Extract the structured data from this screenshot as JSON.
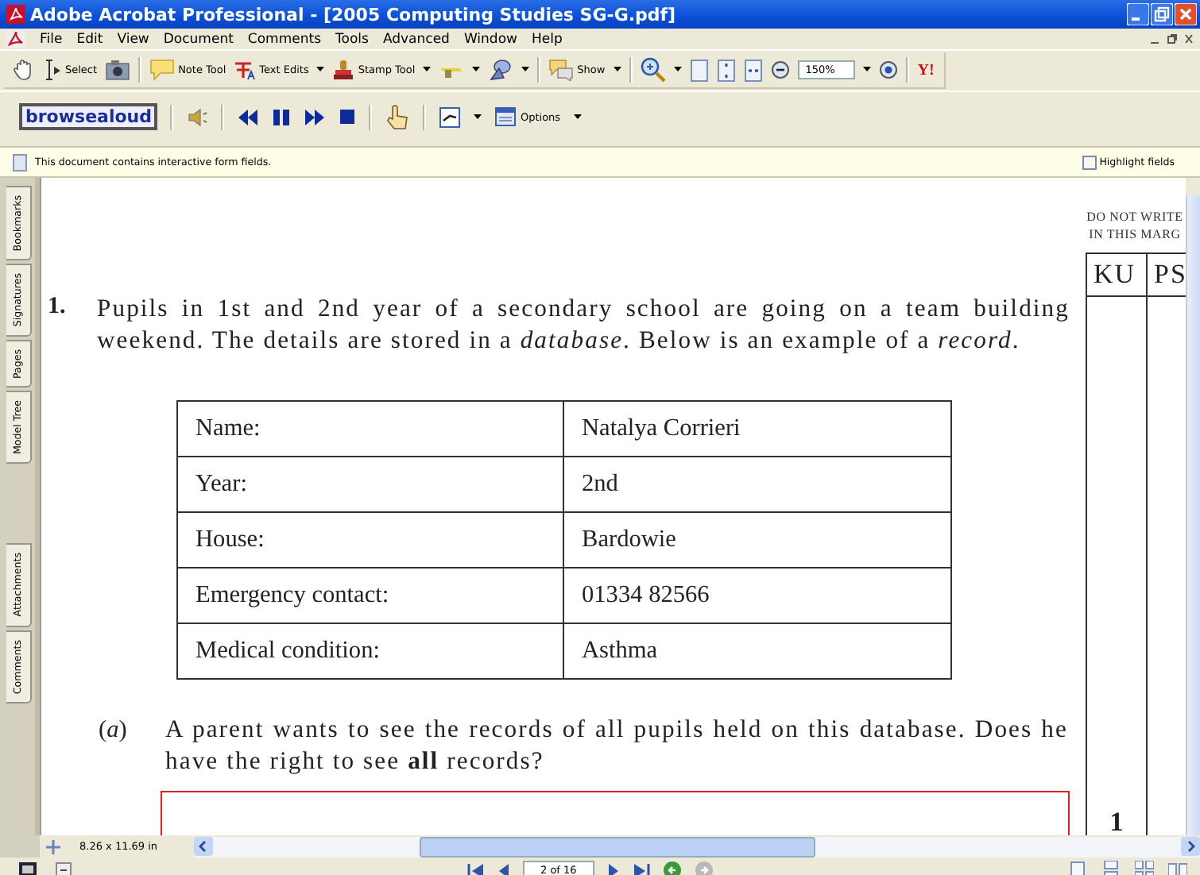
{
  "window": {
    "title": "Adobe Acrobat Professional - [2005 Computing Studies SG-G.pdf]"
  },
  "menu": [
    "File",
    "Edit",
    "View",
    "Document",
    "Comments",
    "Tools",
    "Advanced",
    "Window",
    "Help"
  ],
  "toolbar": [
    {
      "kind": "hand"
    },
    {
      "kind": "select",
      "label": "Select"
    },
    {
      "kind": "snapshot"
    },
    {
      "kind": "sep"
    },
    {
      "kind": "note",
      "label": "Note Tool"
    },
    {
      "kind": "textedit",
      "label": "Text Edits",
      "dropdown": true
    },
    {
      "kind": "stamp",
      "label": "Stamp Tool",
      "dropdown": true
    },
    {
      "kind": "highlight",
      "dropdown": true
    },
    {
      "kind": "shapes",
      "dropdown": true
    },
    {
      "kind": "sep"
    },
    {
      "kind": "show",
      "label": "Show",
      "dropdown": true
    },
    {
      "kind": "sep"
    },
    {
      "kind": "zoomtool",
      "dropdown": true
    },
    {
      "kind": "page"
    },
    {
      "kind": "fitheight"
    },
    {
      "kind": "fitwidth"
    },
    {
      "kind": "zoomout"
    },
    {
      "kind": "zoomfield",
      "value": "150%",
      "dropdown": true
    },
    {
      "kind": "zoomin"
    },
    {
      "kind": "sep"
    },
    {
      "kind": "yahoo",
      "label": "Y!"
    }
  ],
  "reader_toolbar": [
    {
      "kind": "logo",
      "label": "browsealoud"
    },
    {
      "kind": "sep"
    },
    {
      "kind": "speaker"
    },
    {
      "kind": "sep"
    },
    {
      "kind": "rewind"
    },
    {
      "kind": "pause"
    },
    {
      "kind": "forward"
    },
    {
      "kind": "stop"
    },
    {
      "kind": "sep"
    },
    {
      "kind": "pointer"
    },
    {
      "kind": "sep"
    },
    {
      "kind": "screenmask",
      "dropdown": true
    },
    {
      "kind": "options",
      "label": "Options",
      "dropdown": true
    }
  ],
  "notice": {
    "text": "This document contains interactive form fields.",
    "highlight": {
      "label": "Highlight fields",
      "checked": false
    }
  },
  "side_tabs": [
    "Bookmarks",
    "Signatures",
    "Pages",
    "Model Tree",
    "Attachments",
    "Comments"
  ],
  "document": {
    "number": "1.",
    "text": "Pupils in 1st and 2nd year of a secondary school are going on a team building weekend. The details are stored in a *database*. Below is an example of a *record*.",
    "record": [
      {
        "field": "Name:",
        "value": "Natalya Corrieri"
      },
      {
        "field": "Year:",
        "value": "2nd"
      },
      {
        "field": "House:",
        "value": "Bardowie"
      },
      {
        "field": "Emergency contact:",
        "value": "01334 82566"
      },
      {
        "field": "Medical condition:",
        "value": "Asthma"
      }
    ],
    "part": {
      "label": "(*a*)",
      "text": "A parent wants to see the records of all pupils held on this database. Does he have the right to see **all** records?"
    },
    "margin": {
      "note": "DO NOT WRITE IN THIS MARG",
      "columns": [
        "KU",
        "PS"
      ],
      "mark": "1"
    }
  },
  "status": {
    "page_size": "8.26 x 11.69 in",
    "page": "2 of 16"
  }
}
